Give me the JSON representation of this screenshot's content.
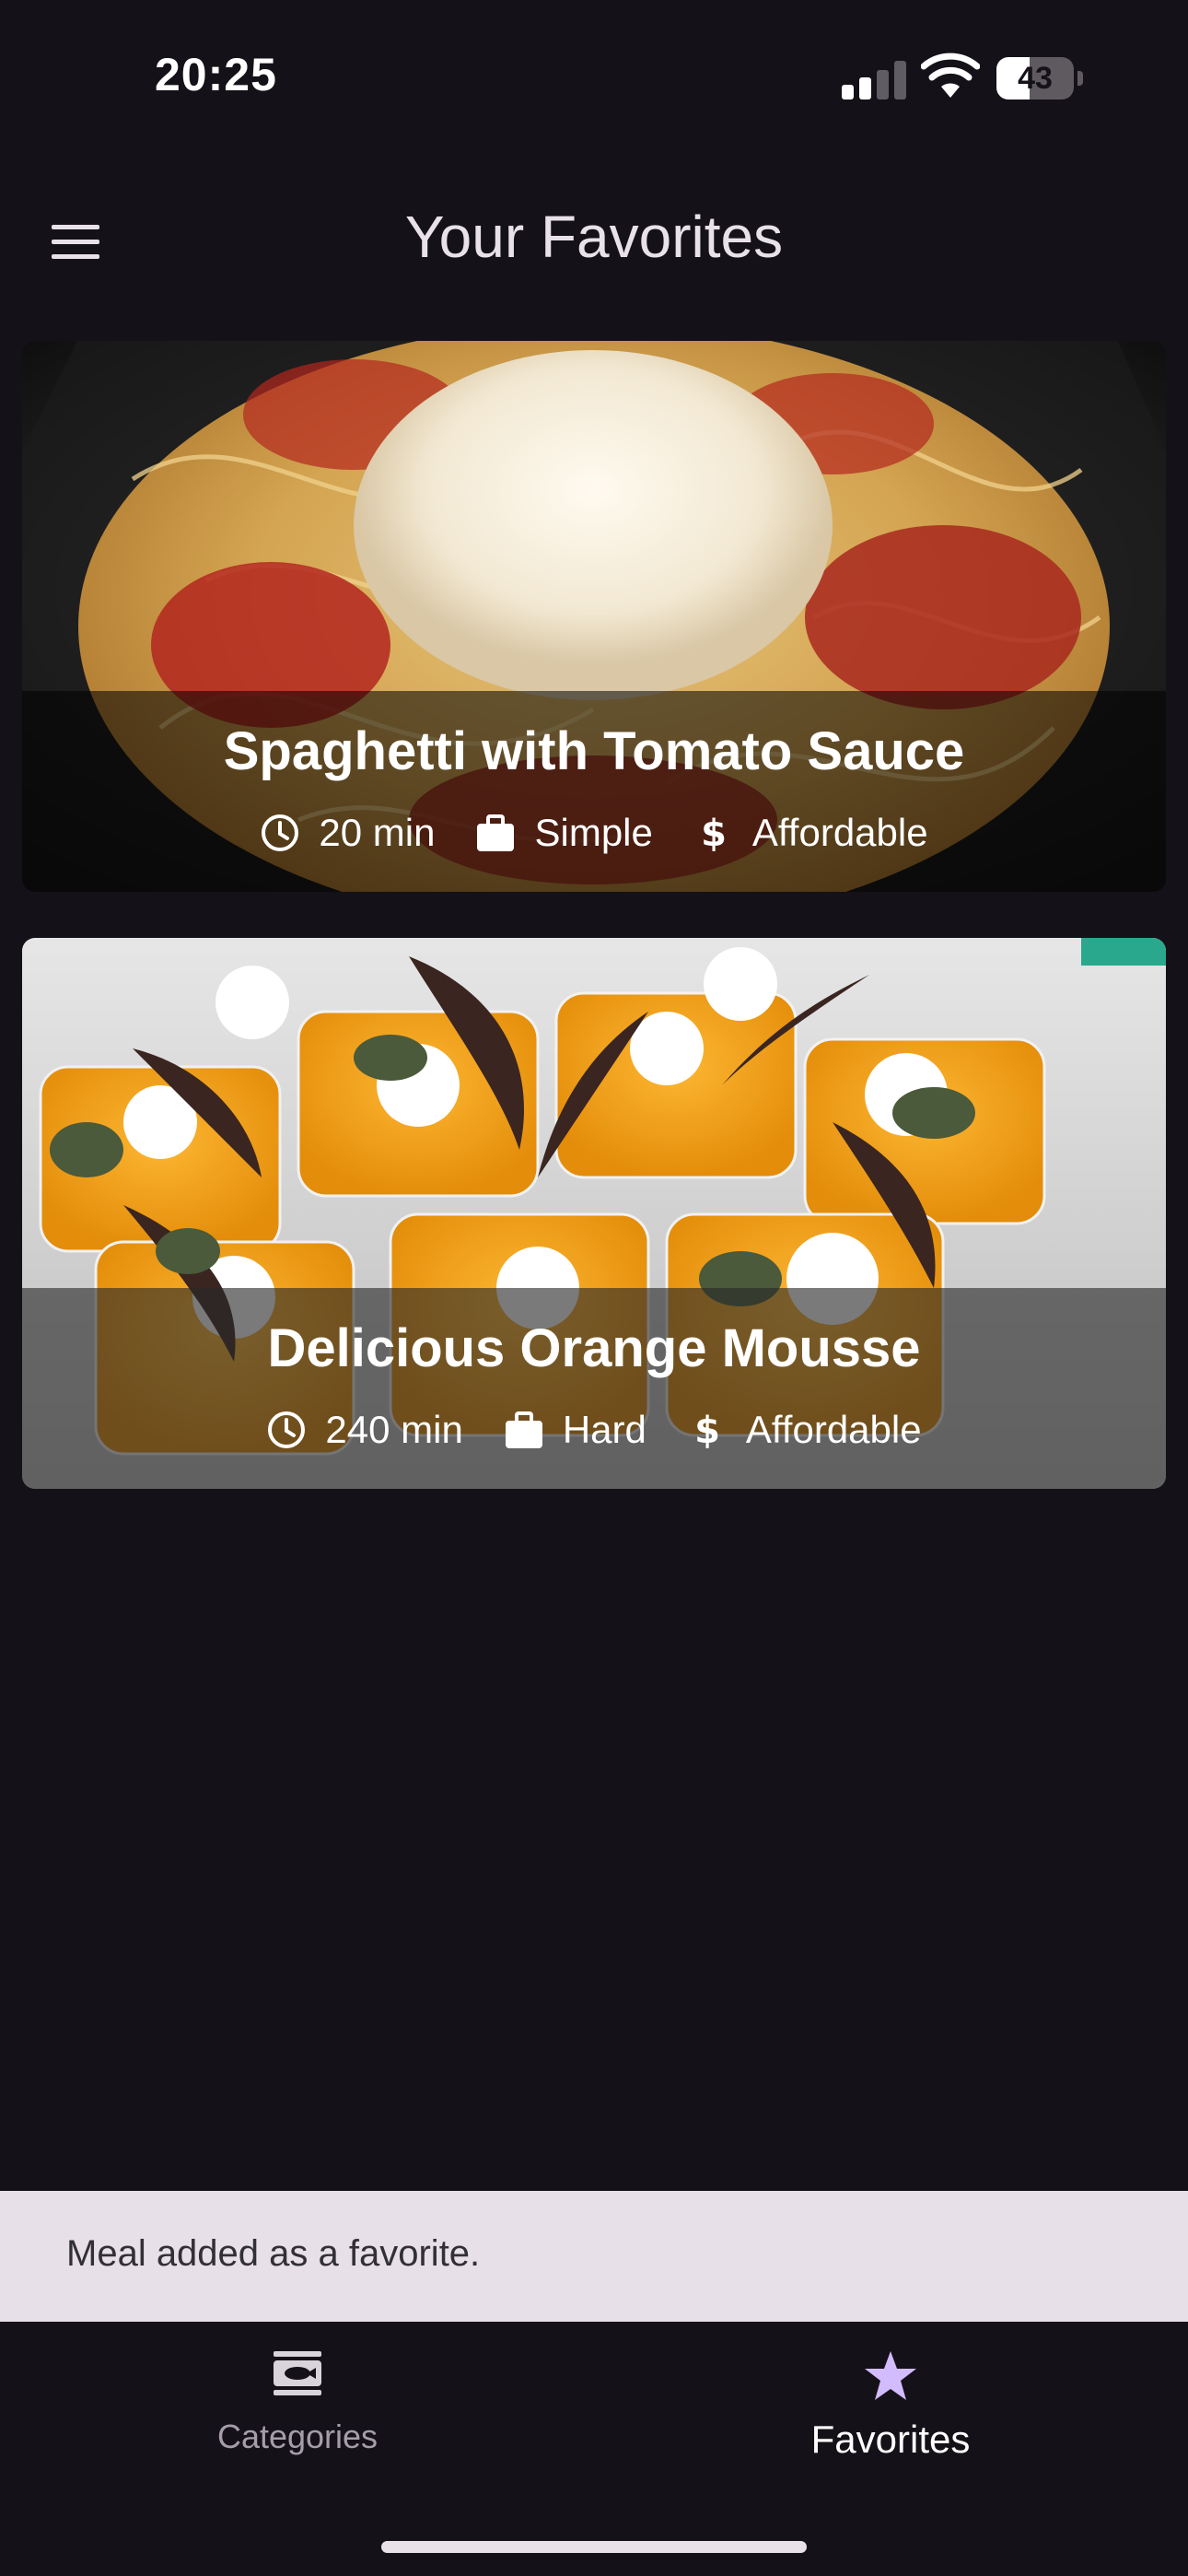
{
  "status_bar": {
    "time": "20:25",
    "battery": "43",
    "battery_level": 0.43
  },
  "header": {
    "title": "Your Favorites",
    "menu_icon": "hamburger-menu-icon"
  },
  "meals": [
    {
      "title": "Spaghetti with Tomato Sauce",
      "duration": "20 min",
      "complexity": "Simple",
      "affordability": "Affordable"
    },
    {
      "title": "Delicious Orange Mousse",
      "duration": "240 min",
      "complexity": "Hard",
      "affordability": "Affordable"
    }
  ],
  "meta_icons": {
    "duration": "clock-icon",
    "complexity": "briefcase-icon",
    "affordability": "dollar-icon"
  },
  "snackbar": {
    "message": "Meal added as a favorite."
  },
  "bottom_nav": {
    "items": [
      {
        "label": "Categories",
        "icon": "categories-icon",
        "selected": false
      },
      {
        "label": "Favorites",
        "icon": "star-icon",
        "selected": true
      }
    ]
  },
  "colors": {
    "background": "#151118",
    "snackbar": "#e7e0e9",
    "selected_nav_icon": "#d2bcfd",
    "text_light": "#e8e2e8"
  }
}
